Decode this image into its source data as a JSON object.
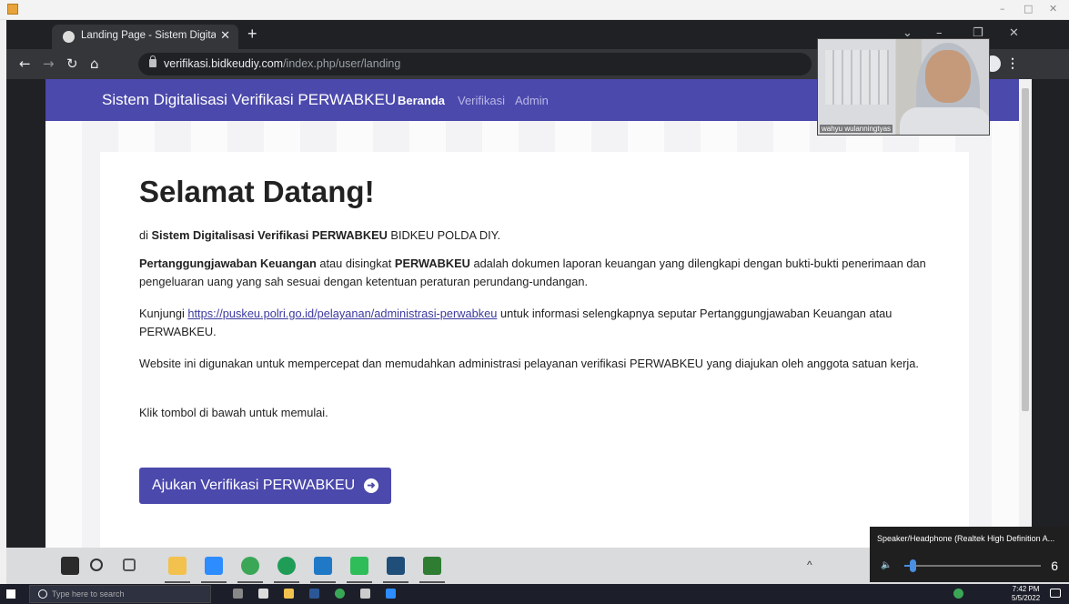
{
  "browser": {
    "tab_title": "Landing Page - Sistem Digitalisasi",
    "url_host": "verifikasi.bidkeudiy.com",
    "url_path": "/index.php/user/landing"
  },
  "navbar": {
    "brand": "Sistem Digitalisasi Verifikasi PERWABKEU",
    "links": [
      "Beranda",
      "Verifikasi",
      "Admin"
    ]
  },
  "page": {
    "heading": "Selamat Datang!",
    "intro_pre": "di ",
    "intro_bold": "Sistem Digitalisasi Verifikasi PERWABKEU",
    "intro_post": " BIDKEU POLDA DIY.",
    "p2_bold1": "Pertanggungjawaban Keuangan",
    "p2_mid": " atau disingkat ",
    "p2_bold2": "PERWABKEU",
    "p2_rest": " adalah dokumen laporan keuangan yang dilengkapi dengan bukti-bukti penerimaan dan pengeluaran uang yang sah sesuai dengan ketentuan peraturan perundang-undangan.",
    "p3_pre": "Kunjungi ",
    "p3_link": "https://puskeu.polri.go.id/pelayanan/administrasi-perwabkeu",
    "p3_post": " untuk informasi selengkapnya seputar Pertanggungjawaban Keuangan atau PERWABKEU.",
    "p4": "Website ini digunakan untuk mempercepat dan memudahkan administrasi pelayanan verifikasi PERWABKEU yang diajukan oleh anggota satuan kerja.",
    "p5": "Klik tombol di bawah untuk memulai.",
    "cta": "Ajukan Verifikasi PERWABKEU"
  },
  "webcam": {
    "name": "wahyu wulanningtyas"
  },
  "volume": {
    "device": "Speaker/Headphone (Realtek High Definition A...",
    "level": 6
  },
  "host_taskbar": {
    "search_placeholder": "Type here to search",
    "time": "7:42 PM",
    "date": "5/5/2022"
  },
  "icons": {
    "omnibox": "lock-icon",
    "cta": "arrow-right-circle-icon"
  },
  "colors": {
    "navbar": "#4b49ac",
    "cta": "#4b49ac",
    "volume_accent": "#4a8fe2"
  }
}
